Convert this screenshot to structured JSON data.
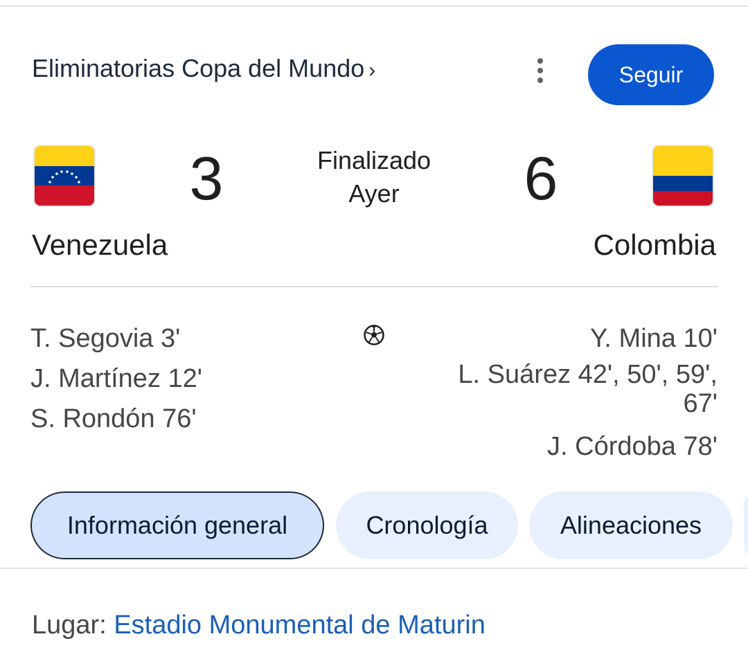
{
  "header": {
    "competition": "Eliminatorias Copa del Mundo",
    "chevron": "›",
    "more_icon": "more-vert-icon",
    "follow_label": "Seguir"
  },
  "match": {
    "status": "Finalizado",
    "day": "Ayer",
    "home": {
      "name": "Venezuela",
      "score": "3",
      "flag_colors": [
        "#FCD116",
        "#003893",
        "#CF142B"
      ]
    },
    "away": {
      "name": "Colombia",
      "score": "6",
      "flag_colors": [
        "#FCD116",
        "#003893",
        "#CE1126"
      ]
    }
  },
  "scorers": {
    "icon": "soccer-ball-icon",
    "home": [
      "T. Segovia 3'",
      "J. Martínez 12'",
      "S. Rondón 76'"
    ],
    "away": [
      "Y. Mina 10'",
      "L. Suárez 42', 50', 59', 67'",
      "J. Córdoba 78'"
    ]
  },
  "tabs": [
    {
      "label": "Información general",
      "active": true
    },
    {
      "label": "Cronología",
      "active": false
    },
    {
      "label": "Alineaciones",
      "active": false
    }
  ],
  "venue": {
    "label": "Lugar: ",
    "name": "Estadio Monumental de Maturin"
  },
  "colors": {
    "accent": "#0b57d0",
    "tab_bg": "#e8f0fe",
    "tab_active_bg": "#d3e3fd",
    "link": "#1a5fb4"
  }
}
